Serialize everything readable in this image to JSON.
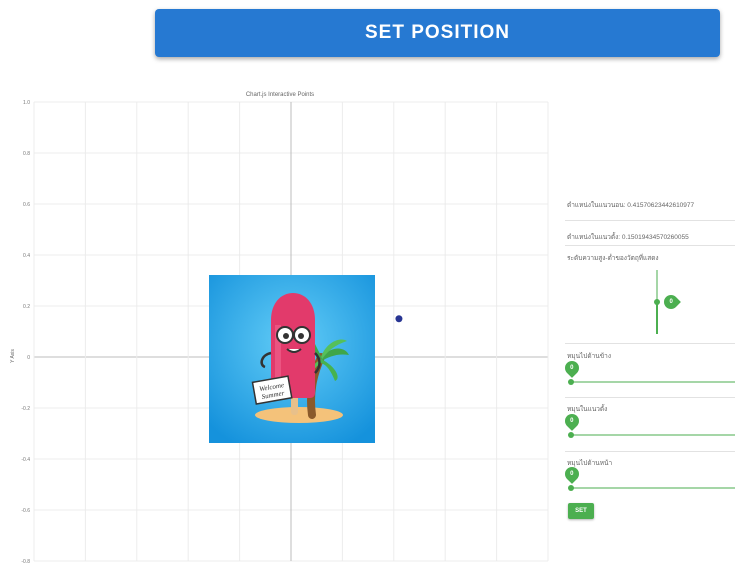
{
  "header": {
    "set_position_label": "SET POSITION"
  },
  "chart_data": {
    "type": "scatter",
    "title": "Chart.js Interactive Points",
    "ylabel": "Y Axis",
    "xlabel": "",
    "ylim": [
      -0.8,
      1.0
    ],
    "xlim": [
      -1.0,
      1.0
    ],
    "y_ticks": [
      "1.0",
      "0.8",
      "0.6",
      "0.4",
      "0.2",
      "0",
      "-0.2",
      "-0.4",
      "-0.6",
      "-0.8"
    ],
    "y_tick_values": [
      1.0,
      0.8,
      0.6,
      0.4,
      0.2,
      0,
      -0.2,
      -0.4,
      -0.6,
      -0.8
    ],
    "x_grid_count": 10,
    "grid": true,
    "points": [
      {
        "x": 0.42,
        "y": 0.15,
        "color": "#283593"
      }
    ]
  },
  "sticker": {
    "text_line1": "Welcome",
    "text_line2": "Summer"
  },
  "controls": {
    "horizontal_position": "ตำแหน่งในแนวนอน: 0.41570623442610977",
    "vertical_position": "ตำแหน่งในแนวตั้ง: 0.15019434570260055",
    "scale_label": "ระดับความสูง-ต่ำของวัตถุที่แสดง",
    "scale_value": "0",
    "rotate_left_right_label": "หมุนไปด้านข้าง",
    "rotate_left_right_value": "0",
    "rotate_vertical_label": "หมุนในแนวตั้ง",
    "rotate_vertical_value": "0",
    "rotate_front_label": "หมุนไปด้านหน้า",
    "rotate_front_value": "0",
    "set_label": "SET"
  },
  "colors": {
    "primary_blue": "#2679d2",
    "green": "#4caf50",
    "sticker_bg": "#1e9fe6"
  }
}
